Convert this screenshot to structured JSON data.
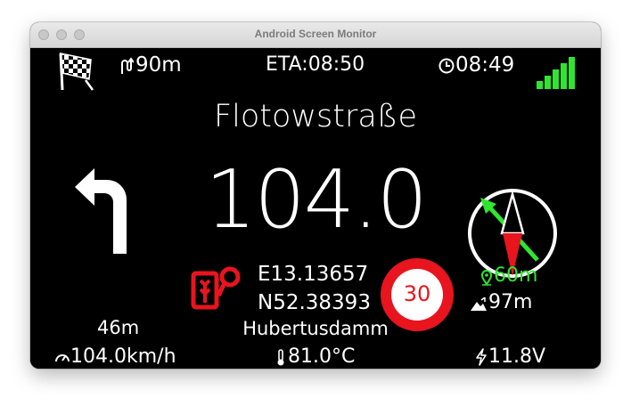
{
  "window": {
    "title": "Android Screen Monitor"
  },
  "top_bar": {
    "distance_to_turn": "90m",
    "eta": "ETA:08:50",
    "clock": "08:49",
    "signal_bars": 5
  },
  "nav": {
    "street_name": "Flotowstraße",
    "speed": "104.0",
    "turn_direction": "left",
    "turn_distance": "46m",
    "speed_limit": "30",
    "coord_e": "E13.13657",
    "coord_n": "N52.38393",
    "next_street": "Hubertusdamm",
    "gps_accuracy": "60m",
    "altitude": "97m"
  },
  "bottom_bar": {
    "speed_kmh": "104.0km/h",
    "temperature": "81.0°C",
    "voltage": "11.8V"
  },
  "colors": {
    "accent_green": "#2ee62e",
    "red": "#e8141e",
    "background": "#000000",
    "text": "#ffffff"
  }
}
